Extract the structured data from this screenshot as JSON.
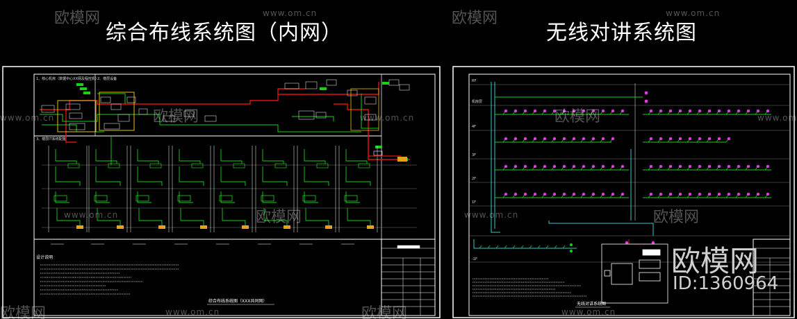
{
  "titles": {
    "left": "综合布线系统图（内网）",
    "right": "无线对讲系统图"
  },
  "watermarks": {
    "logo_text": "欧模网",
    "url_text": "www.om.cn"
  },
  "brand": {
    "name": "欧模网",
    "id": "ID:1360964"
  },
  "left_drawing": {
    "caption": "综合布线系统图（XXX共同网）",
    "notes_heading": "设计说明",
    "section_labels": [
      "1、核心机房（数据中心XX网及程控机）",
      "2、楼层设备",
      "3、楼层IT系统配置"
    ]
  },
  "right_drawing": {
    "caption": "无线对讲系统图",
    "floor_labels": [
      "RF",
      "机房层",
      "4F",
      "3F",
      "2F",
      "1F",
      "-1F"
    ]
  },
  "colors": {
    "background": "#000000",
    "frame": "#ffffff",
    "network_red": "#e01010",
    "network_green": "#19d119",
    "riser_cyan": "#33cccc",
    "antenna_magenta": "#e23be2",
    "grid_gray": "#7a7a7a"
  }
}
